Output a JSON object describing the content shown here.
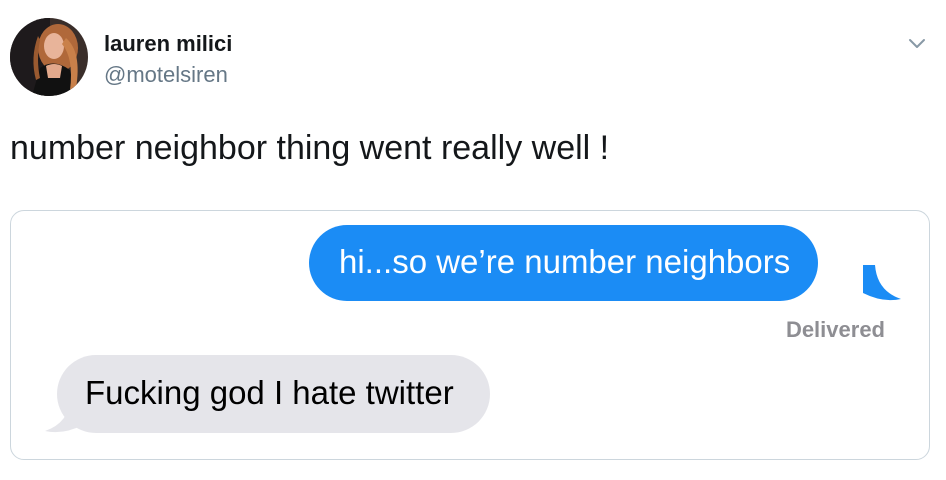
{
  "tweet": {
    "author_name": "lauren milici",
    "author_handle": "@motelsiren",
    "text": "number neighbor thing went really well !",
    "more_icon": "chevron-down-icon"
  },
  "imessage": {
    "sent_message": "hi...so we’re number neighbors",
    "sent_status": "Delivered",
    "received_message": "Fucking god I hate twitter",
    "sent_bubble_color": "#1b8cf5",
    "received_bubble_color": "#e5e5ea"
  }
}
